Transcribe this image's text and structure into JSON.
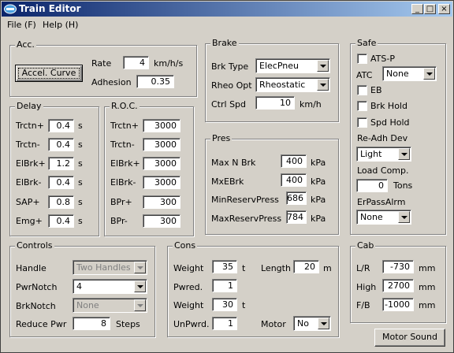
{
  "window": {
    "title": "Train Editor"
  },
  "titlebar_buttons": {
    "minimize": "_",
    "maximize": "□",
    "close": "×"
  },
  "menu": {
    "file": "File (F)",
    "help": "Help (H)"
  },
  "acc": {
    "title": "Acc.",
    "accel_curve_button": "Accel. Curve",
    "rate_label": "Rate",
    "rate_value": "4",
    "rate_unit": "km/h/s",
    "adhesion_label": "Adhesion",
    "adhesion_value": "0.35"
  },
  "delay": {
    "title": "Delay",
    "rows": [
      {
        "label": "Trctn+",
        "value": "0.4",
        "unit": "s"
      },
      {
        "label": "Trctn-",
        "value": "0.4",
        "unit": "s"
      },
      {
        "label": "ElBrk+",
        "value": "1.2",
        "unit": "s"
      },
      {
        "label": "ElBrk-",
        "value": "0.4",
        "unit": "s"
      },
      {
        "label": "SAP+",
        "value": "0.8",
        "unit": "s"
      },
      {
        "label": "Emg+",
        "value": "0.4",
        "unit": "s"
      }
    ]
  },
  "roc": {
    "title": "R.O.C.",
    "rows": [
      {
        "label": "Trctn+",
        "value": "3000"
      },
      {
        "label": "Trctn-",
        "value": "3000"
      },
      {
        "label": "ElBrk+",
        "value": "3000"
      },
      {
        "label": "ElBrk-",
        "value": "3000"
      },
      {
        "label": "BPr+",
        "value": "300"
      },
      {
        "label": "BPr-",
        "value": "300"
      }
    ]
  },
  "brake": {
    "title": "Brake",
    "brk_type_label": "Brk Type",
    "brk_type_value": "ElecPneu",
    "rheo_opt_label": "Rheo Opt",
    "rheo_opt_value": "Rheostatic",
    "ctrl_spd_label": "Ctrl Spd",
    "ctrl_spd_value": "10",
    "ctrl_spd_unit": "km/h"
  },
  "pres": {
    "title": "Pres",
    "rows": [
      {
        "label": "Max N Brk",
        "value": "400",
        "unit": "kPa"
      },
      {
        "label": "MxEBrk",
        "value": "400",
        "unit": "kPa"
      },
      {
        "label": "MinReservPress",
        "value": "686",
        "unit": "kPa"
      },
      {
        "label": "MaxReservPress",
        "value": "784",
        "unit": "kPa"
      }
    ]
  },
  "safe": {
    "title": "Safe",
    "ats_p": "ATS-P",
    "atc_label": "ATC",
    "atc_value": "None",
    "eb": "EB",
    "brk_hold": "Brk Hold",
    "spd_hold": "Spd Hold",
    "readh_label": "Re-Adh Dev",
    "readh_value": "Light",
    "load_comp_label": "Load Comp.",
    "load_comp_value": "0",
    "load_comp_unit": "Tons",
    "erpass_label": "ErPassAlrm",
    "erpass_value": "None"
  },
  "controls": {
    "title": "Controls",
    "handle_label": "Handle",
    "handle_value": "Two Handles",
    "pwr_notch_label": "PwrNotch",
    "pwr_notch_value": "4",
    "brk_notch_label": "BrkNotch",
    "brk_notch_value": "None",
    "reduce_pwr_label": "Reduce Pwr",
    "reduce_pwr_value": "8",
    "reduce_pwr_unit": "Steps"
  },
  "cons": {
    "title": "Cons",
    "weight_label": "Weight",
    "weight_value": "35",
    "weight_unit": "t",
    "length_label": "Length",
    "length_value": "20",
    "length_unit": "m",
    "pwred_label": "Pwred.",
    "pwred_value": "1",
    "weight2_label": "Weight",
    "weight2_value": "30",
    "weight2_unit": "t",
    "unpwrd_label": "UnPwrd.",
    "unpwrd_value": "1",
    "motor_label": "Motor",
    "motor_value": "No"
  },
  "cab": {
    "title": "Cab",
    "rows": [
      {
        "label": "L/R",
        "value": "-730",
        "unit": "mm"
      },
      {
        "label": "High",
        "value": "2700",
        "unit": "mm"
      },
      {
        "label": "F/B",
        "value": "-1000",
        "unit": "mm"
      }
    ]
  },
  "motor_sound_button": "Motor Sound"
}
